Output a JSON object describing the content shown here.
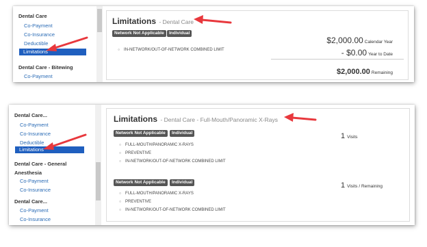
{
  "panel1": {
    "sidebar": {
      "group1": "Dental Care",
      "links": [
        "Co-Payment",
        "Co-Insurance",
        "Deductible"
      ],
      "active": "Limitations",
      "group2": "Dental Care - Bitewing",
      "group2_links": [
        "Co-Payment"
      ]
    },
    "title": "Limitations",
    "subtitle": "- Dental Care",
    "badges": [
      "Network Not Applicable",
      "Individual"
    ],
    "bullets": [
      "IN-NETWORK/OUT-OF-NETWORK COMBINED LIMIT"
    ],
    "amounts": [
      {
        "value": "$2,000.00",
        "label": "Calendar Year"
      },
      {
        "value": "- $0.00",
        "label": "Year to Date"
      },
      {
        "value": "$2,000.00",
        "label": "Remaining"
      }
    ]
  },
  "panel2": {
    "sidebar": {
      "group1": "Dental Care...",
      "links": [
        "Co-Payment",
        "Co-Insurance",
        "Deductible"
      ],
      "active": "Limitations",
      "group2": "Dental Care - General Anesthesia",
      "group2_links": [
        "Co-Payment",
        "Co-Insurance"
      ],
      "group3": "Dental Care...",
      "group3_links": [
        "Co-Payment",
        "Co-Insurance"
      ]
    },
    "title": "Limitations",
    "subtitle": "- Dental Care - Full-Mouth/Panoramic X-Rays",
    "block1": {
      "badges": [
        "Network Not Applicable",
        "Individual"
      ],
      "bullets": [
        "FULL-MOUTH/PANORAMIC X-RAYS",
        "PREVENTIVE",
        "IN-NETWORK/OUT-OF-NETWORK COMBINED LIMIT"
      ],
      "value": "1",
      "label": "Visits"
    },
    "block2": {
      "badges": [
        "Network Not Applicable",
        "Individual"
      ],
      "bullets": [
        "FULL-MOUTH/PANORAMIC X-RAYS",
        "PREVENTIVE",
        "IN-NETWORK/OUT-OF-NETWORK COMBINED LIMIT"
      ],
      "value": "1",
      "label": "Visits / Remaining"
    }
  },
  "colors": {
    "arrow": "#e8383d",
    "active_bg": "#1f5fbf",
    "link": "#2a6bb5",
    "badge": "#555555"
  }
}
